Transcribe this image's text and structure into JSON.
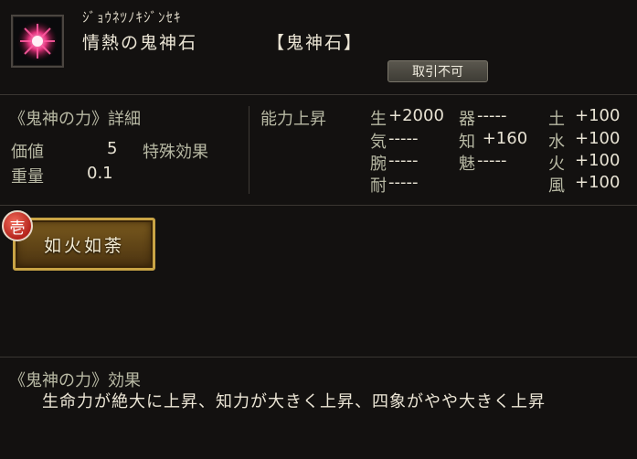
{
  "item": {
    "reading": "ｼﾞｮｳﾈﾂﾉｷｼﾞﾝｾｷ",
    "name": "情熱の鬼神石",
    "category": "【鬼神石】",
    "trade_status": "取引不可"
  },
  "details": {
    "title": "《鬼神の力》詳細",
    "value_label": "価値",
    "value": "5",
    "special_effect_label": "特殊効果",
    "weight_label": "重量",
    "weight": "0.1"
  },
  "ability": {
    "title": "能力上昇",
    "stats": [
      {
        "label": "生",
        "value": "+2000"
      },
      {
        "label": "気",
        "value": "-----"
      },
      {
        "label": "腕",
        "value": "-----"
      },
      {
        "label": "耐",
        "value": "-----"
      },
      {
        "label": "器",
        "value": "-----"
      },
      {
        "label": "知",
        "value": " +160"
      },
      {
        "label": "魅",
        "value": "-----"
      },
      {
        "label": "土",
        "value": "+100"
      },
      {
        "label": "水",
        "value": "+100"
      },
      {
        "label": "火",
        "value": "+100"
      },
      {
        "label": "風",
        "value": "+100"
      }
    ]
  },
  "skill": {
    "badge": "壱",
    "label": "如火如荼"
  },
  "effect": {
    "title": "《鬼神の力》効果",
    "text": "生命力が絶大に上昇、知力が大きく上昇、四象がやや大きく上昇"
  },
  "colors": {
    "background": "#131110",
    "label": "#b8b9a4",
    "skill_border": "#c9a445",
    "badge": "#c0281e"
  }
}
